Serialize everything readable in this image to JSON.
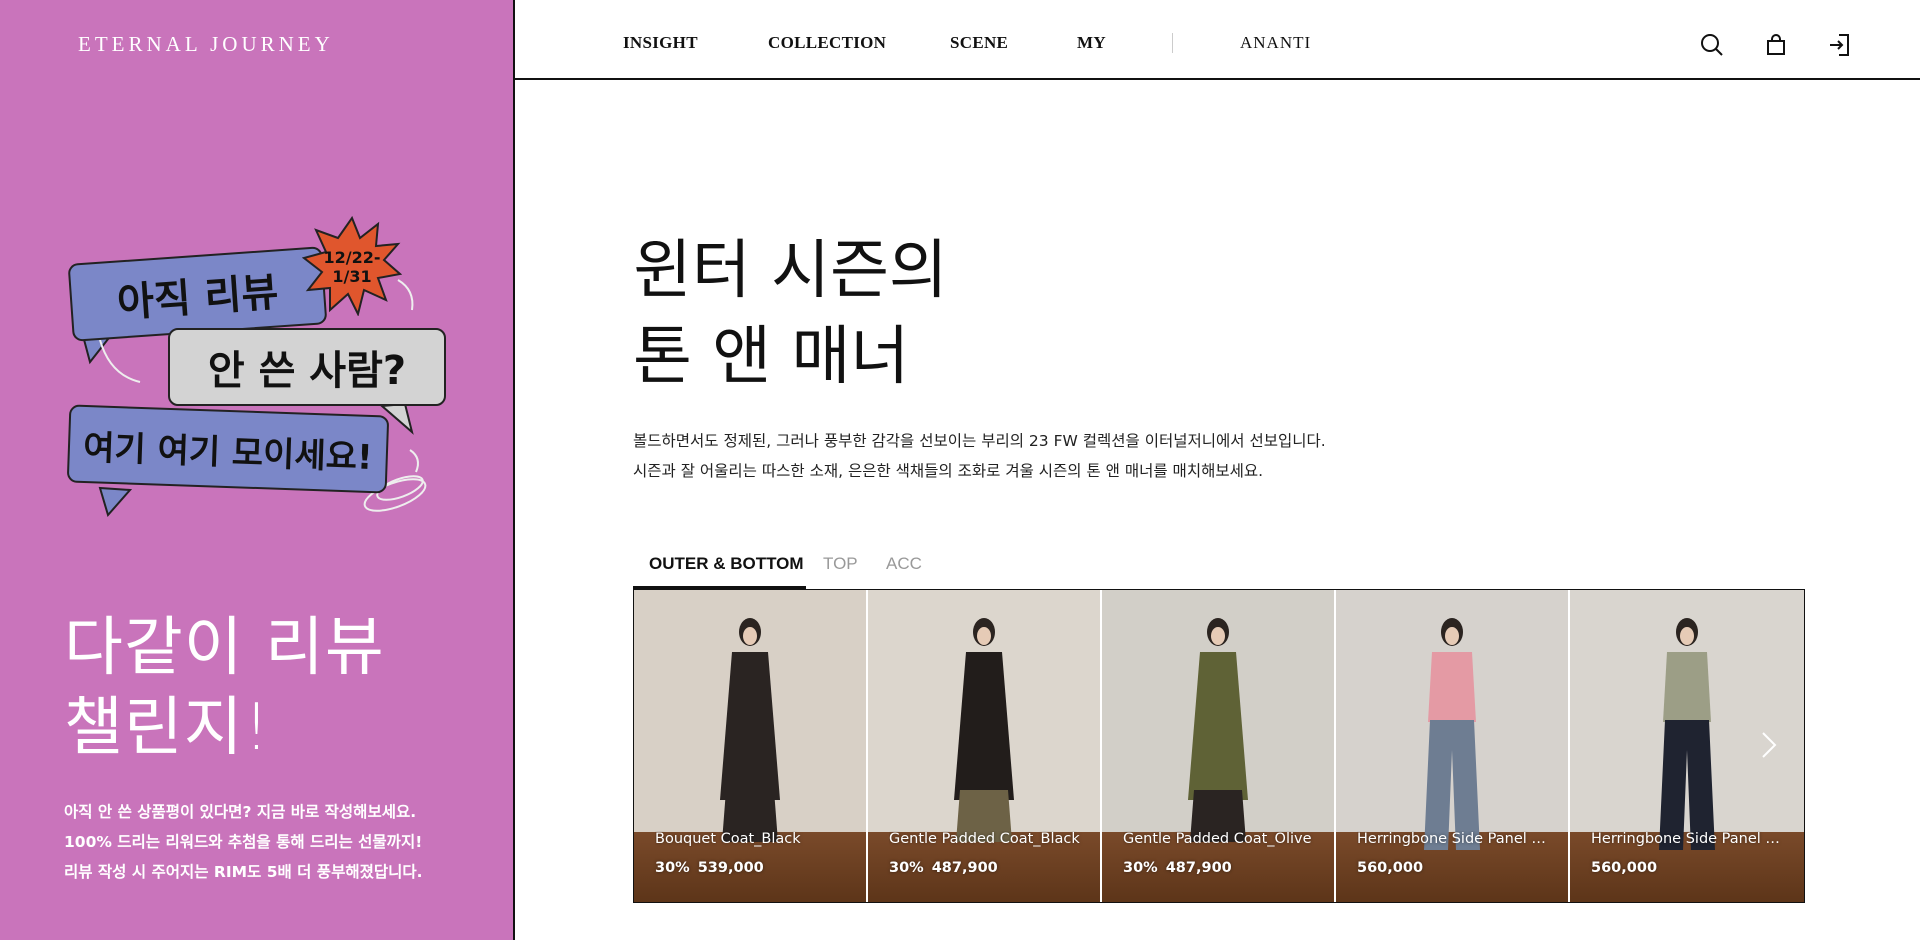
{
  "left": {
    "brand": "ETERNAL JOURNEY",
    "promo": {
      "bubble1": "아직 리뷰",
      "bubble2": "안 쓴 사람?",
      "bubble3": "여기 여기 모이세요!",
      "date_line1": "12/22-",
      "date_line2": "1/31",
      "bubble1_color": "#7b87c8",
      "bubble2_color": "#d3d3d3",
      "burst_color": "#e0562d"
    },
    "challenge_line1": "다같이 리뷰",
    "challenge_line2": "챌린지!",
    "desc_line1": "아직 안 쓴 상품평이 있다면? 지금 바로 작성해보세요.",
    "desc_line2": "100% 드리는 리워드와 추첨을 통해 드리는 선물까지!",
    "desc_line3": "리뷰 작성 시 주어지는 RIM도 5배 더 풍부해졌답니다.",
    "panel_color": "#c974bb"
  },
  "nav": {
    "items": [
      "INSIGHT",
      "COLLECTION",
      "SCENE",
      "MY"
    ],
    "partner": "ANANTI",
    "icons": [
      "search-icon",
      "cart-icon",
      "login-icon"
    ]
  },
  "main": {
    "headline_line1": "윈터 시즌의",
    "headline_line2": "톤 앤 매너",
    "intro_line1": "볼드하면서도 정제된, 그러나 풍부한 감각을 선보이는 부리의 23 FW 컬렉션을 이터널저니에서 선보입니다.",
    "intro_line2": "시즌과 잘 어울리는 따스한 소재, 은은한 색채들의 조화로 겨울 시즌의 톤 앤 매너를 매치해보세요.",
    "tabs": [
      {
        "label": "OUTER & BOTTOM",
        "active": true
      },
      {
        "label": "TOP",
        "active": false
      },
      {
        "label": "ACC",
        "active": false
      }
    ],
    "products": [
      {
        "name": "Bouquet Coat_Black",
        "discount": "30%",
        "price": "539,000",
        "garment_color": "#2a2422",
        "bg": "#d8d0c6"
      },
      {
        "name": "Gentle Padded Coat_Black",
        "discount": "30%",
        "price": "487,900",
        "garment_color": "#221d1b",
        "bg": "#dcd6cd"
      },
      {
        "name": "Gentle Padded Coat_Olive",
        "discount": "30%",
        "price": "487,900",
        "garment_color": "#5f6236",
        "bg": "#d2cfc8"
      },
      {
        "name": "Herringbone Side Panel Denim Pants_Blue",
        "discount": "",
        "price": "560,000",
        "garment_color": "#e49aa4",
        "bg": "#d6d2cd"
      },
      {
        "name": "Herringbone Side Panel Denim Pants_Black",
        "discount": "",
        "price": "560,000",
        "garment_color": "#9c9e86",
        "bg": "#d9d5cf"
      }
    ]
  }
}
